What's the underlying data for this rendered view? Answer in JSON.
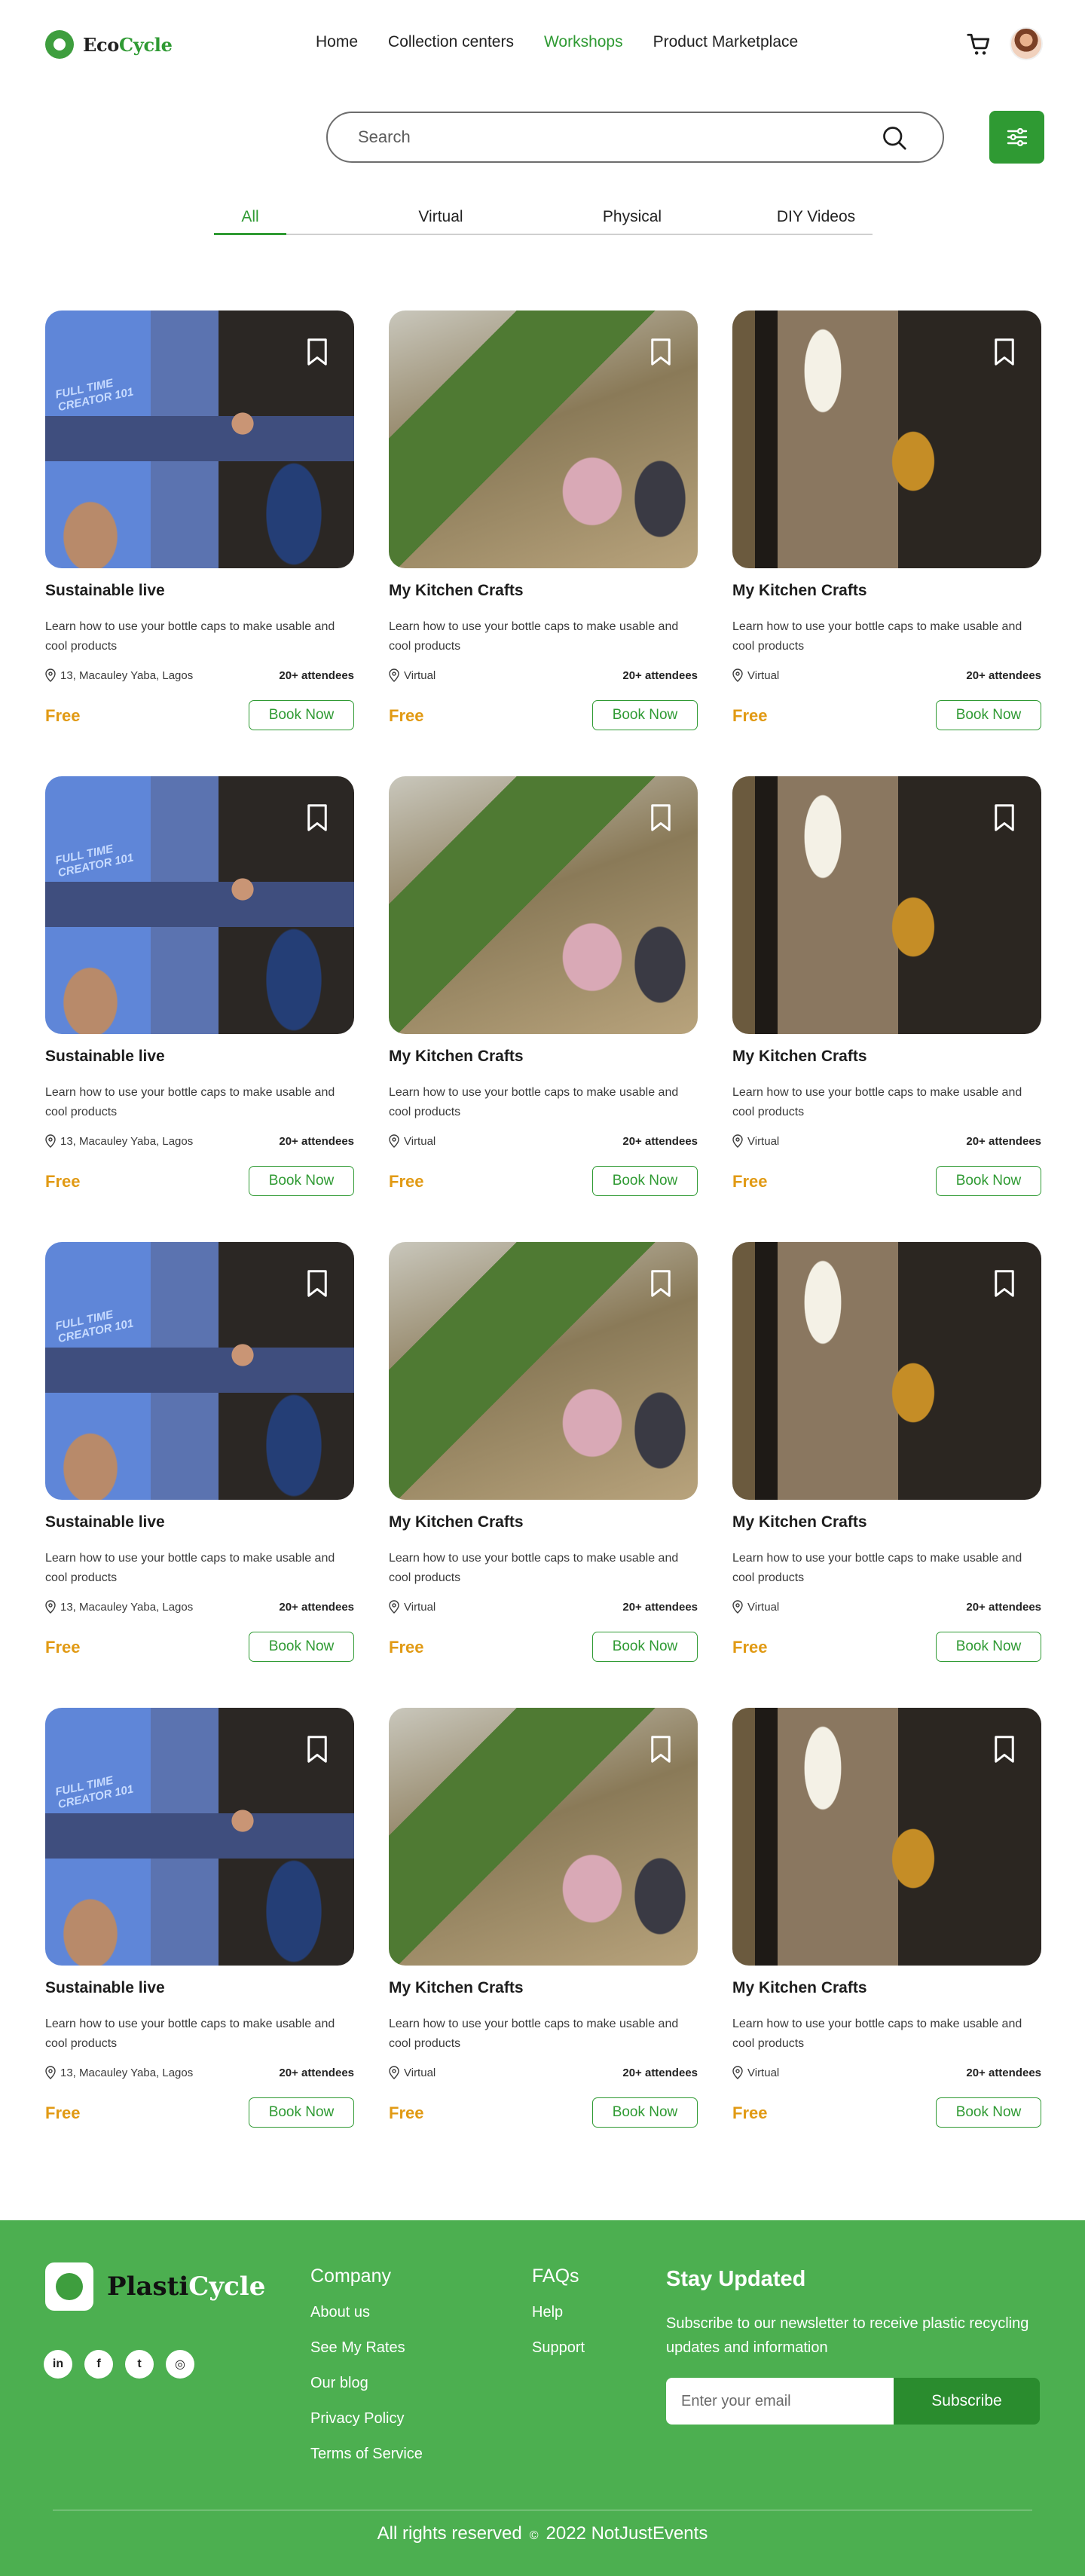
{
  "brand": {
    "part1": "Eco",
    "part2": "Cycle"
  },
  "nav": {
    "items": [
      {
        "label": "Home",
        "active": false
      },
      {
        "label": "Collection centers",
        "active": false
      },
      {
        "label": "Workshops",
        "active": true
      },
      {
        "label": "Product Marketplace",
        "active": false
      }
    ]
  },
  "icons": {
    "cart": "shopping-cart-icon",
    "search": "search-icon",
    "filter": "sliders-icon",
    "bookmark": "bookmark-icon",
    "location": "location-pin-icon"
  },
  "search": {
    "placeholder": "Search"
  },
  "tabs": [
    {
      "label": "All",
      "active": true
    },
    {
      "label": "Virtual",
      "active": false
    },
    {
      "label": "Physical",
      "active": false
    },
    {
      "label": "DIY Videos",
      "active": false
    }
  ],
  "cards": [
    {
      "title": "Sustainable live",
      "desc": "Learn how to use your bottle caps to make usable and cool products",
      "location": "13, Macauley Yaba, Lagos",
      "attendees": "20+ attendees",
      "price": "Free",
      "button": "Book Now"
    },
    {
      "title": "My Kitchen Crafts",
      "desc": "Learn how to use your bottle caps to make usable and cool products",
      "location": "Virtual",
      "attendees": "20+ attendees",
      "price": "Free",
      "button": "Book Now"
    },
    {
      "title": "My Kitchen Crafts",
      "desc": "Learn how to use your bottle caps to make usable and cool products",
      "location": "Virtual",
      "attendees": "20+ attendees",
      "price": "Free",
      "button": "Book Now"
    },
    {
      "title": "Sustainable live",
      "desc": "Learn how to use your bottle caps to make usable and cool products",
      "location": "13, Macauley Yaba, Lagos",
      "attendees": "20+ attendees",
      "price": "Free",
      "button": "Book Now"
    },
    {
      "title": "My Kitchen Crafts",
      "desc": "Learn how to use your bottle caps to make usable and cool products",
      "location": "Virtual",
      "attendees": "20+ attendees",
      "price": "Free",
      "button": "Book Now"
    },
    {
      "title": "My Kitchen Crafts",
      "desc": "Learn how to use your bottle caps to make usable and cool products",
      "location": "Virtual",
      "attendees": "20+ attendees",
      "price": "Free",
      "button": "Book Now"
    },
    {
      "title": "Sustainable live",
      "desc": "Learn how to use your bottle caps to make usable and cool products",
      "location": "13, Macauley Yaba, Lagos",
      "attendees": "20+ attendees",
      "price": "Free",
      "button": "Book Now"
    },
    {
      "title": "My Kitchen Crafts",
      "desc": "Learn how to use your bottle caps to make usable and cool products",
      "location": "Virtual",
      "attendees": "20+ attendees",
      "price": "Free",
      "button": "Book Now"
    },
    {
      "title": "My Kitchen Crafts",
      "desc": "Learn how to use your bottle caps to make usable and cool products",
      "location": "Virtual",
      "attendees": "20+ attendees",
      "price": "Free",
      "button": "Book Now"
    },
    {
      "title": "Sustainable live",
      "desc": "Learn how to use your bottle caps to make usable and cool products",
      "location": "13, Macauley Yaba, Lagos",
      "attendees": "20+ attendees",
      "price": "Free",
      "button": "Book Now"
    },
    {
      "title": "My Kitchen Crafts",
      "desc": "Learn how to use your bottle caps to make usable and cool products",
      "location": "Virtual",
      "attendees": "20+ attendees",
      "price": "Free",
      "button": "Book Now"
    },
    {
      "title": "My Kitchen Crafts",
      "desc": "Learn how to use your bottle caps to make usable and cool products",
      "location": "Virtual",
      "attendees": "20+ attendees",
      "price": "Free",
      "button": "Book Now"
    }
  ],
  "footer": {
    "brand": {
      "part1": "Plasti",
      "part2": "Cycle"
    },
    "socials": [
      {
        "icon": "linkedin-icon",
        "glyph": "in"
      },
      {
        "icon": "facebook-icon",
        "glyph": "f"
      },
      {
        "icon": "twitter-icon",
        "glyph": "t"
      },
      {
        "icon": "instagram-icon",
        "glyph": "◎"
      }
    ],
    "company": {
      "heading": "Company",
      "links": [
        "About us",
        "See My Rates",
        "Our blog",
        "Privacy Policy",
        "Terms of Service"
      ]
    },
    "faqs": {
      "heading": "FAQs",
      "links": [
        "Help",
        "Support"
      ]
    },
    "newsletter": {
      "heading": "Stay Updated",
      "text": "Subscribe to our newsletter to receive plastic recycling updates and information",
      "placeholder": "Enter your email",
      "button": "Subscribe"
    },
    "copyright": {
      "left": "All rights reserved",
      "symbol": "©",
      "right": "2022 NotJustEvents"
    }
  },
  "colors": {
    "brand_green": "#2f9a33",
    "footer_green": "#4caf50",
    "price_orange": "#e19a14"
  }
}
